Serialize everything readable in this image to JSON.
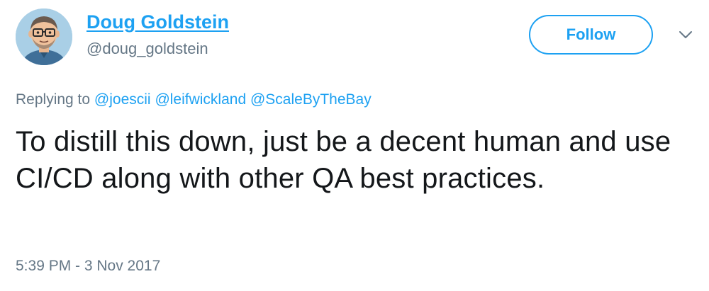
{
  "author": {
    "display_name": "Doug Goldstein",
    "handle": "@doug_goldstein",
    "avatar_icon": "cartoon-avatar-icon"
  },
  "follow_button": {
    "label": "Follow"
  },
  "menu": {
    "icon": "chevron-down-icon"
  },
  "reply": {
    "prefix": "Replying to",
    "mentions": [
      "@joescii",
      "@leifwickland",
      "@ScaleByTheBay"
    ]
  },
  "tweet": {
    "text": "To distill this down, just be a decent human and use CI/CD along with other QA best practices."
  },
  "timestamp": "5:39 PM - 3 Nov 2017",
  "colors": {
    "accent": "#1da1f2",
    "secondary_text": "#657786",
    "primary_text": "#14171a"
  }
}
